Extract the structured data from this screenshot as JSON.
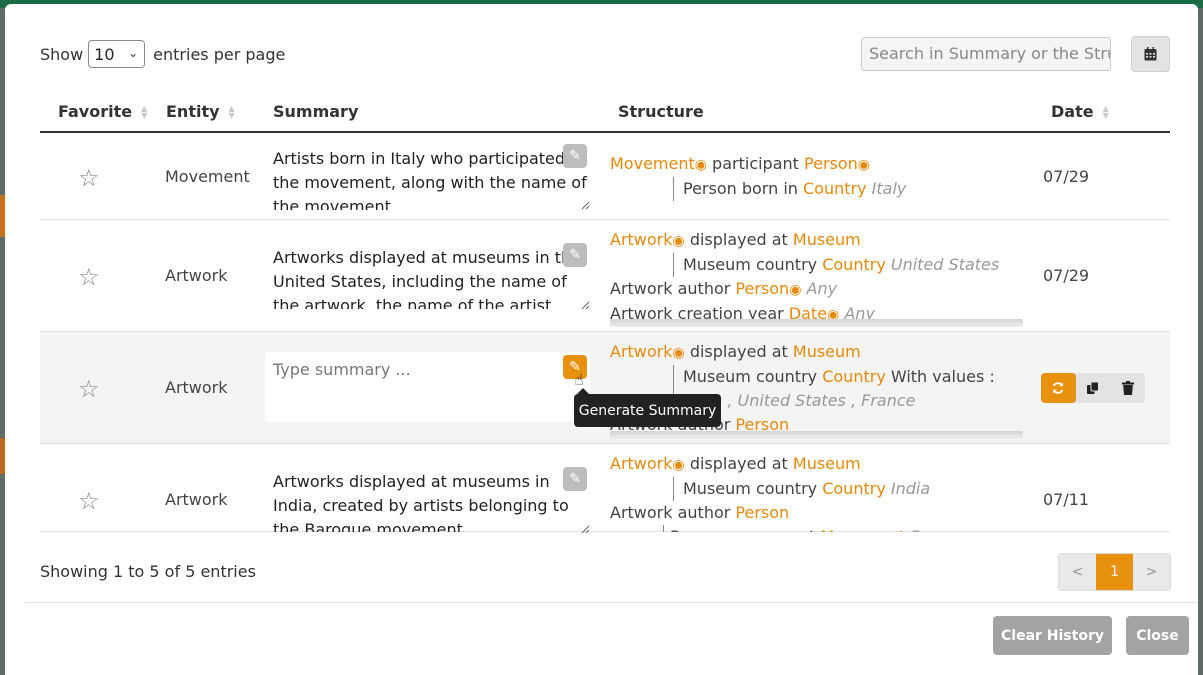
{
  "toolbar": {
    "show_label": "Show",
    "per_page_value": "10",
    "entries_label": "entries per page",
    "search_placeholder": "Search in Summary or the Structure",
    "calendar_icon": "calendar-icon"
  },
  "table": {
    "headers": [
      "Favorite",
      "Entity",
      "Summary",
      "Structure",
      "Date"
    ],
    "rows": [
      {
        "entity": "Movement",
        "summary": "Artists born in Italy who participated in the movement, along with the name of the movement",
        "structure": [
          {
            "parts": [
              {
                "t": "Movement",
                "c": "ent"
              },
              {
                "t": "◉",
                "c": "eye"
              },
              {
                "t": " participant "
              },
              {
                "t": "Person",
                "c": "ent"
              },
              {
                "t": "◉",
                "c": "eye"
              }
            ]
          },
          {
            "indent": true,
            "parts": [
              {
                "t": "Person born in "
              },
              {
                "t": "Country",
                "c": "ent"
              },
              {
                "t": " "
              },
              {
                "t": "Italy",
                "c": "val"
              }
            ]
          }
        ],
        "date": "07/29"
      },
      {
        "entity": "Artwork",
        "summary": "Artworks displayed at museums in the United States, including the name of the artwork, the name of the artist, and the",
        "structure": [
          {
            "parts": [
              {
                "t": "Artwork",
                "c": "ent"
              },
              {
                "t": "◉",
                "c": "eye"
              },
              {
                "t": " displayed at "
              },
              {
                "t": "Museum",
                "c": "ent"
              }
            ]
          },
          {
            "indent": true,
            "parts": [
              {
                "t": "Museum country "
              },
              {
                "t": "Country",
                "c": "ent"
              },
              {
                "t": " "
              },
              {
                "t": "United States",
                "c": "val"
              }
            ]
          },
          {
            "parts": [
              {
                "t": "Artwork author "
              },
              {
                "t": "Person",
                "c": "ent"
              },
              {
                "t": "◉",
                "c": "eye"
              },
              {
                "t": " "
              },
              {
                "t": "Any",
                "c": "val"
              }
            ]
          },
          {
            "parts": [
              {
                "t": "Artwork creation year "
              },
              {
                "t": "Date",
                "c": "ent"
              },
              {
                "t": "◉",
                "c": "eye"
              },
              {
                "t": " "
              },
              {
                "t": "Any",
                "c": "val"
              }
            ]
          }
        ],
        "date": "07/29"
      },
      {
        "entity": "Artwork",
        "summary_placeholder": "Type summary ...",
        "structure": [
          {
            "parts": [
              {
                "t": "Artwork",
                "c": "ent"
              },
              {
                "t": "◉",
                "c": "eye"
              },
              {
                "t": " displayed at "
              },
              {
                "t": "Museum",
                "c": "ent"
              }
            ]
          },
          {
            "indent": true,
            "parts": [
              {
                "t": "Museum country "
              },
              {
                "t": "Country",
                "c": "ent"
              },
              {
                "t": " With values :"
              }
            ]
          },
          {
            "indent": true,
            "parts": [
              {
                "t": "India , United States , France",
                "c": "val"
              }
            ]
          },
          {
            "parts": [
              {
                "t": "Artwork author "
              },
              {
                "t": "Person",
                "c": "ent"
              }
            ]
          }
        ],
        "date": ""
      },
      {
        "entity": "Artwork",
        "summary": "Artworks displayed at museums in India, created by artists belonging to the Baroque movement",
        "structure": [
          {
            "parts": [
              {
                "t": "Artwork",
                "c": "ent"
              },
              {
                "t": "◉",
                "c": "eye"
              },
              {
                "t": " displayed at "
              },
              {
                "t": "Museum",
                "c": "ent"
              }
            ]
          },
          {
            "indent": true,
            "parts": [
              {
                "t": "Museum country "
              },
              {
                "t": "Country",
                "c": "ent"
              },
              {
                "t": " "
              },
              {
                "t": "India",
                "c": "val"
              }
            ]
          },
          {
            "parts": [
              {
                "t": "Artwork author "
              },
              {
                "t": "Person",
                "c": "ent"
              }
            ]
          },
          {
            "indent2": true,
            "parts": [
              {
                "t": "Person movement "
              },
              {
                "t": "Movement",
                "c": "ent"
              },
              {
                "t": " Baroque",
                "c": "val"
              }
            ]
          }
        ],
        "date": "07/11"
      }
    ]
  },
  "tooltip": "Generate Summary",
  "footer": {
    "info": "Showing 1 to 5 of 5 entries",
    "pager": [
      "<",
      "1",
      ">"
    ],
    "clear_history": "Clear History",
    "close": "Close"
  },
  "colors": {
    "accent": "#e8910f",
    "entity_text": "#e8890c",
    "disabled_button": "#a3a3a3"
  }
}
